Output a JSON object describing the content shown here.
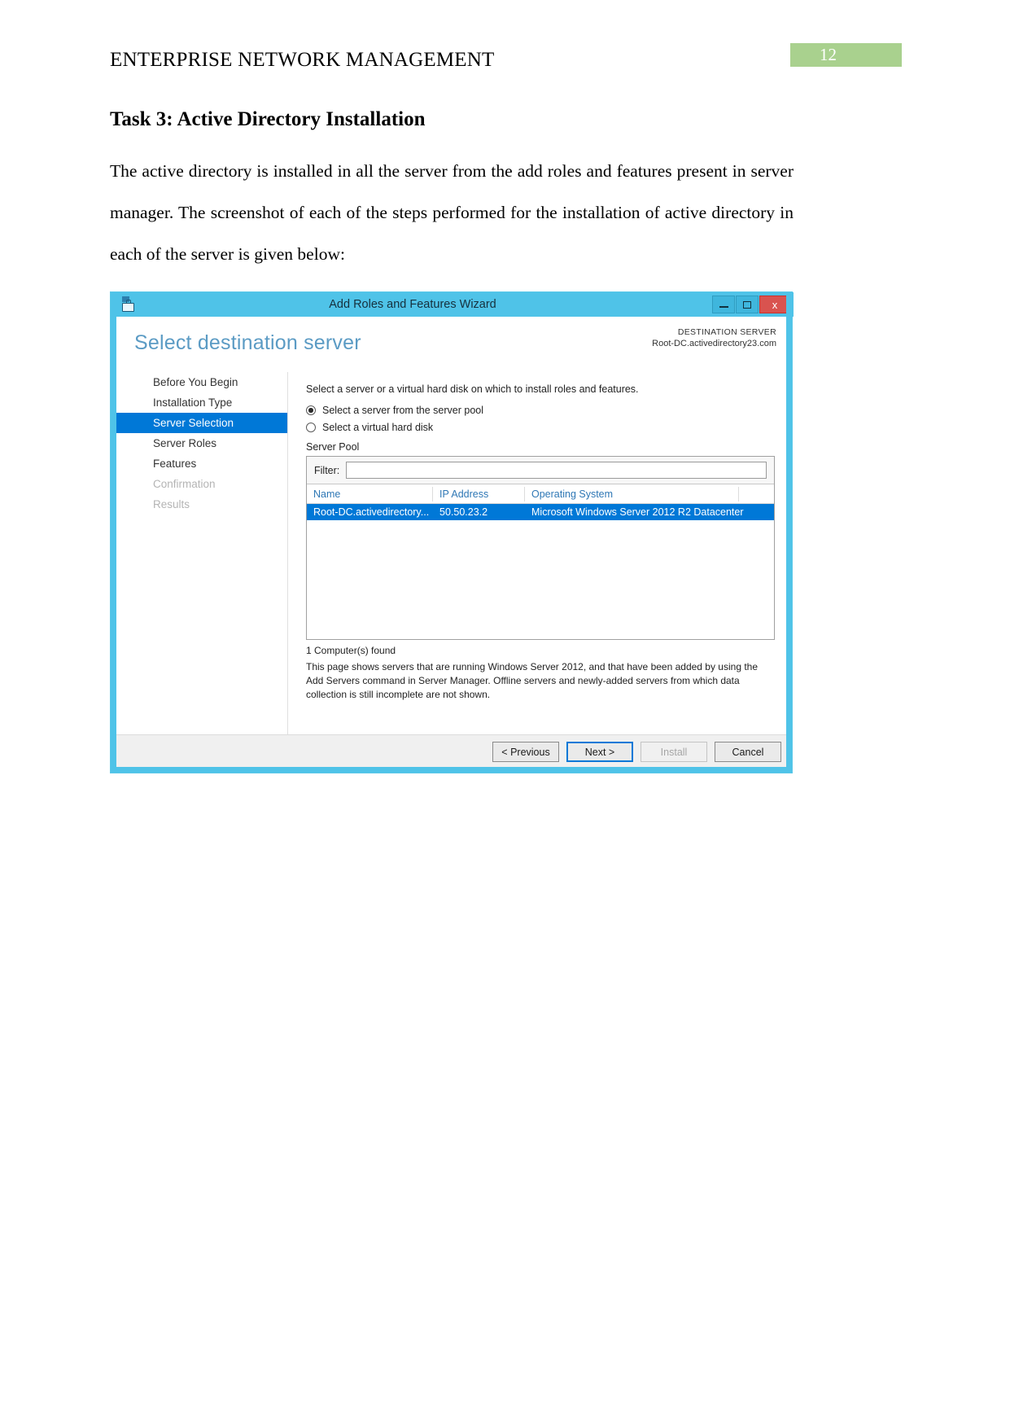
{
  "document": {
    "header_title": "ENTERPRISE NETWORK MANAGEMENT",
    "page_number": "12",
    "page_badge_color": "#a9d18e",
    "section_title": "Task 3: Active Directory Installation",
    "paragraph": "The active directory is installed in all the server from the add roles and features present in server manager. The screenshot of each of the steps performed for the installation of active directory in each of the server is given below:"
  },
  "wizard": {
    "title": "Add Roles and Features Wizard",
    "titlebar_color": "#4fc3e8",
    "window_controls": {
      "minimize": "–",
      "maximize": "□",
      "close": "x"
    },
    "heading": "Select destination server",
    "heading_color": "#5b9bc4",
    "destination": {
      "label": "DESTINATION SERVER",
      "value": "Root-DC.activedirectory23.com"
    },
    "nav_items": [
      {
        "label": "Before You Begin",
        "state": "normal"
      },
      {
        "label": "Installation Type",
        "state": "normal"
      },
      {
        "label": "Server Selection",
        "state": "active"
      },
      {
        "label": "Server Roles",
        "state": "normal"
      },
      {
        "label": "Features",
        "state": "normal"
      },
      {
        "label": "Confirmation",
        "state": "disabled"
      },
      {
        "label": "Results",
        "state": "disabled"
      }
    ],
    "content": {
      "description": "Select a server or a virtual hard disk on which to install roles and features.",
      "radio_options": [
        {
          "label": "Select a server from the server pool",
          "checked": true
        },
        {
          "label": "Select a virtual hard disk",
          "checked": false
        }
      ],
      "pool_label": "Server Pool",
      "filter_label": "Filter:",
      "filter_value": "",
      "filter_placeholder": "",
      "table": {
        "columns": [
          "Name",
          "IP Address",
          "Operating System"
        ],
        "rows": [
          {
            "name": "Root-DC.activedirectory...",
            "ip": "50.50.23.2",
            "os": "Microsoft Windows Server 2012 R2 Datacenter",
            "selected": true
          }
        ]
      },
      "found_text": "1 Computer(s) found",
      "note": "This page shows servers that are running Windows Server 2012, and that have been added by using the Add Servers command in Server Manager. Offline servers and newly-added servers from which data collection is still incomplete are not shown."
    },
    "footer_buttons": [
      {
        "label": "< Previous",
        "state": "normal"
      },
      {
        "label": "Next >",
        "state": "primary"
      },
      {
        "label": "Install",
        "state": "disabled"
      },
      {
        "label": "Cancel",
        "state": "normal"
      }
    ]
  }
}
